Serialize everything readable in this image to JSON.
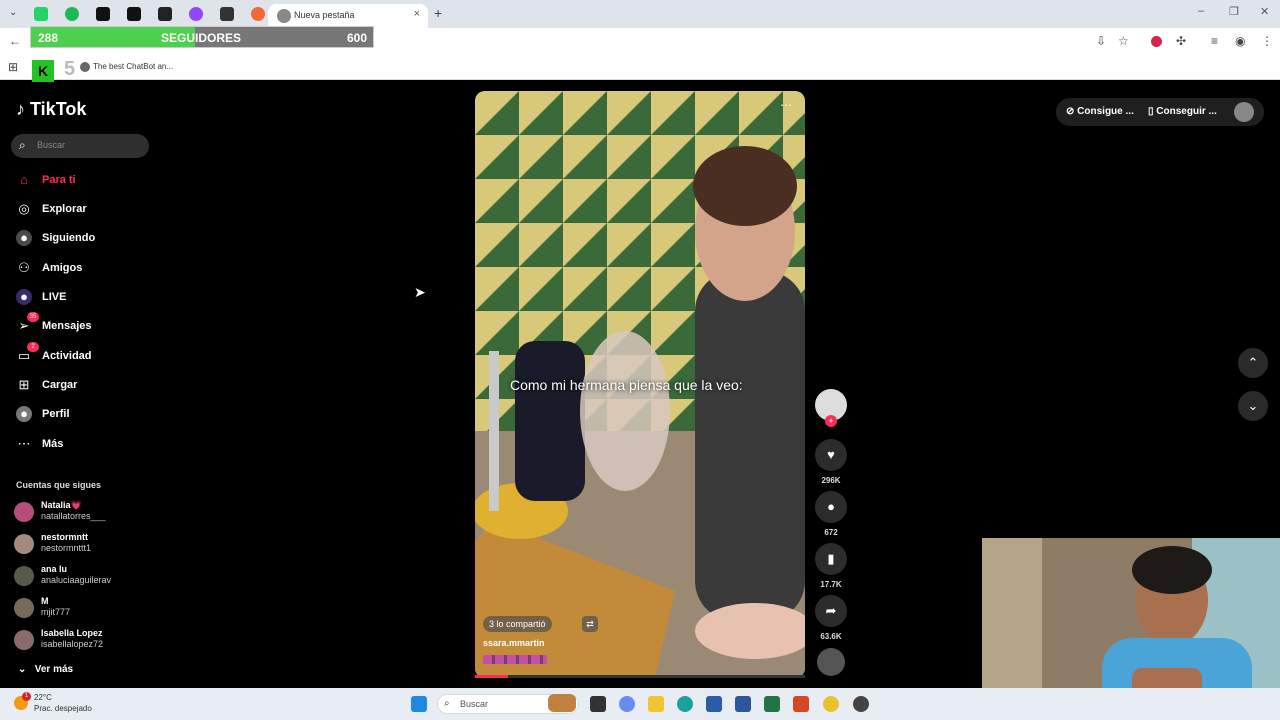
{
  "browser": {
    "active_tab_title": "Nueva pestaña",
    "bookmark_label": "The best ChatBot an...",
    "new_tab_symbol": "+",
    "close_symbol": "×"
  },
  "overlay": {
    "current": "288",
    "label": "SEGUIDORES",
    "goal": "600",
    "progress": 0.48,
    "kick_letter": "K",
    "kick_number": "5"
  },
  "sidebar": {
    "logo": "TikTok",
    "search_placeholder": "Buscar",
    "nav": [
      {
        "label": "Para ti",
        "icon": "home-icon"
      },
      {
        "label": "Explorar",
        "icon": "compass-icon"
      },
      {
        "label": "Siguiendo",
        "icon": "following-icon"
      },
      {
        "label": "Amigos",
        "icon": "friends-icon"
      },
      {
        "label": "LIVE",
        "icon": "live-icon"
      },
      {
        "label": "Mensajes",
        "icon": "messages-icon",
        "badge": "35"
      },
      {
        "label": "Actividad",
        "icon": "activity-icon",
        "badge": "2"
      },
      {
        "label": "Cargar",
        "icon": "upload-icon"
      },
      {
        "label": "Perfil",
        "icon": "profile-icon"
      },
      {
        "label": "Más",
        "icon": "more-icon"
      }
    ],
    "following_title": "Cuentas que sigues",
    "following": [
      {
        "name": "Natalia💗",
        "user": "natallatorres___"
      },
      {
        "name": "nestormntt",
        "user": "nestormnttt1"
      },
      {
        "name": "ana lu",
        "user": "analuciaaguilerav"
      },
      {
        "name": "M",
        "user": "mjit777"
      },
      {
        "name": "Isabella Lopez",
        "user": "isabellalopez72"
      }
    ],
    "see_more": "Ver más"
  },
  "video": {
    "caption": "Como mi hermana piensa que la veo:",
    "shared": "3 lo compartió",
    "username": "ssara.mmartin",
    "likes": "296K",
    "comments": "672",
    "saves": "17.7K",
    "shares": "63.6K",
    "progress": 0.1
  },
  "top_right": {
    "btn1": "Consigue ...",
    "btn2": "Conseguir ..."
  },
  "taskbar": {
    "temperature": "22°C",
    "weather": "Prac. despejado",
    "search": "Buscar",
    "weather_badge": "1"
  },
  "colors": {
    "accent": "#fe2c55",
    "overlay_fill": "#4dd04d"
  }
}
